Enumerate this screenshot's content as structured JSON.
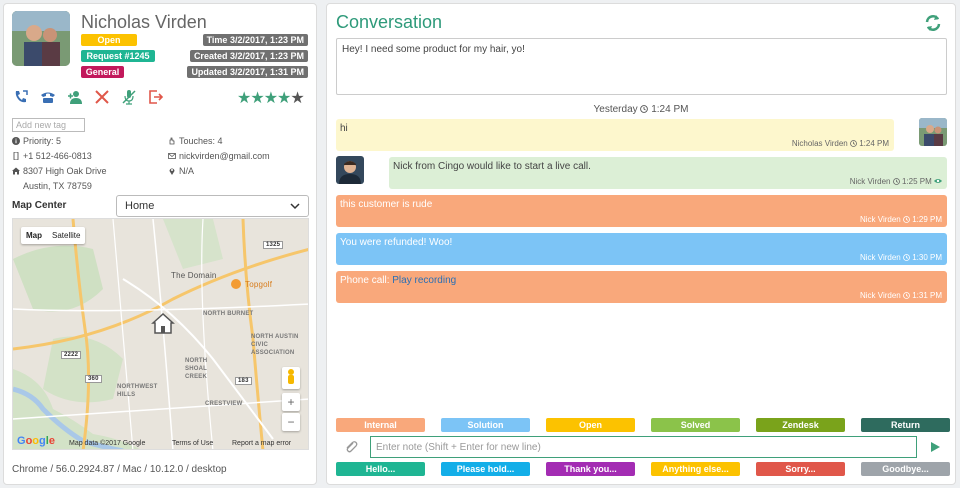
{
  "contact": {
    "name": "Nicholas Virden",
    "status": "Open",
    "request": "Request #1245",
    "category": "General",
    "time": "Time 3/2/2017, 1:23 PM",
    "created": "Created 3/2/2017, 1:23 PM",
    "updated": "Updated 3/2/2017, 1:31 PM",
    "rating": 4,
    "rating_max": 5,
    "tag_placeholder": "Add new tag",
    "priority": "Priority: 5",
    "touches": "Touches: 4",
    "phone": "+1 512-466-0813",
    "email": "nickvirden@gmail.com",
    "address1": "8307 High Oak Drive",
    "address2": "Austin, TX 78759",
    "location": "N/A"
  },
  "actions": [
    {
      "name": "call-icon",
      "color": "#3a6fb4"
    },
    {
      "name": "phone-icon",
      "color": "#3a6fb4"
    },
    {
      "name": "add-user-icon",
      "color": "#3fa07a"
    },
    {
      "name": "close-icon",
      "color": "#e0574a"
    },
    {
      "name": "mic-off-icon",
      "color": "#3fa07a"
    },
    {
      "name": "sign-out-icon",
      "color": "#e0574a"
    }
  ],
  "map": {
    "label": "Map Center",
    "selected": "Home",
    "type_map": "Map",
    "type_satellite": "Satellite",
    "poi_domain": "The Domain",
    "poi_topgolf": "Topgolf",
    "area1": "NORTH BURNET",
    "area2": "NORTH AUSTIN CIVIC ASSOCIATION",
    "area3": "NORTH SHOAL CREEK",
    "area4": "NORTHWEST HILLS",
    "area5": "CRESTVIEW",
    "road1": "360",
    "road2": "2222",
    "road3": "183",
    "road4": "1325",
    "logo": "Google",
    "footer_data": "Map data ©2017 Google",
    "footer_terms": "Terms of Use",
    "footer_report": "Report a map error"
  },
  "browser": "Chrome / 56.0.2924.87 / Mac / 10.12.0 / desktop",
  "conversation": {
    "title": "Conversation",
    "first_message": "Hey! I need some product for my hair, yo!",
    "day": "Yesterday",
    "day_time": "1:24 PM",
    "messages": [
      {
        "text": "hi",
        "meta": "Nicholas Virden",
        "time": "1:24 PM",
        "color": "#fdf7cd"
      },
      {
        "text": "Nick from Cingo would like to start a live call.",
        "meta": "Nick Virden",
        "time": "1:25 PM",
        "color": "#dcefd6"
      },
      {
        "text": "this customer is rude",
        "meta": "Nick Virden",
        "time": "1:29 PM",
        "color": "#f9a87b"
      },
      {
        "text": "You were refunded! Woo!",
        "meta": "Nick Virden",
        "time": "1:30 PM",
        "color": "#7cc4f6"
      },
      {
        "text": "Phone call:",
        "link": "Play recording",
        "meta": "Nick Virden",
        "time": "1:31 PM",
        "color": "#f9a87b"
      }
    ],
    "status_buttons": [
      {
        "label": "Internal",
        "color": "#f9a87b"
      },
      {
        "label": "Solution",
        "color": "#7cc4f6"
      },
      {
        "label": "Open",
        "color": "#fcc200"
      },
      {
        "label": "Solved",
        "color": "#8bc34a"
      },
      {
        "label": "Zendesk",
        "color": "#7aa31b"
      },
      {
        "label": "Return",
        "color": "#2e6b5e"
      }
    ],
    "note_placeholder": "Enter note (Shift + Enter for new line)",
    "macro_buttons": [
      {
        "label": "Hello...",
        "color": "#1fb593"
      },
      {
        "label": "Please hold...",
        "color": "#13aee8"
      },
      {
        "label": "Thank you...",
        "color": "#a32cb3"
      },
      {
        "label": "Anything else...",
        "color": "#fcc200"
      },
      {
        "label": "Sorry...",
        "color": "#e0574a"
      },
      {
        "label": "Goodbye...",
        "color": "#9ea4aa"
      }
    ]
  }
}
